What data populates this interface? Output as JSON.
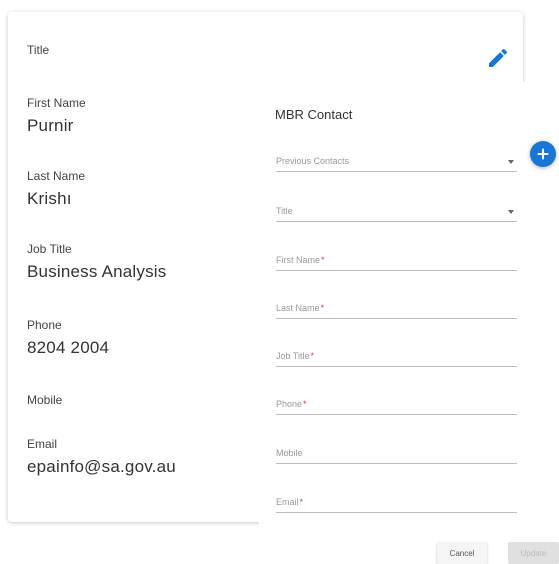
{
  "contact_card": {
    "title_label": "Title",
    "first_name_label": "First Name",
    "first_name_value": "Purnir",
    "last_name_label": "Last Name",
    "last_name_value": "Krishı",
    "job_title_label": "Job Title",
    "job_title_value": "Business Analysis",
    "phone_label": "Phone",
    "phone_value": "8204 2004",
    "mobile_label": "Mobile",
    "email_label": "Email",
    "email_value": "epainfo@sa.gov.au"
  },
  "form": {
    "title": "MBR Contact",
    "previous_contacts_label": "Previous Contacts",
    "title_label": "Title",
    "first_name_label": "First Name",
    "last_name_label": "Last Name",
    "job_title_label": "Job Title",
    "phone_label": "Phone",
    "mobile_label": "Mobile",
    "email_label": "Email",
    "required_marker": "*",
    "cancel_label": "Cancel",
    "update_label": "Update"
  },
  "colors": {
    "accent": "#1976d2",
    "required": "#e53935"
  },
  "icons": {
    "edit": "pencil-icon",
    "add": "plus-icon"
  }
}
